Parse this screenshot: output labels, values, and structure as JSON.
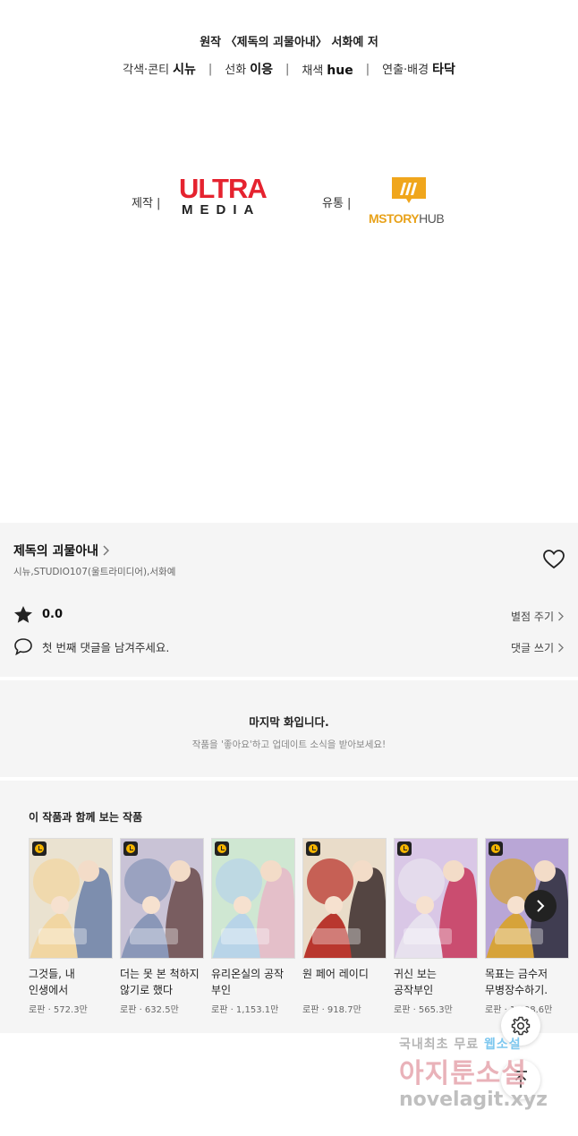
{
  "credits": {
    "original": "원작 〈제독의 괴물아내〉 서화예 저",
    "roles": [
      {
        "role": "각색·콘티",
        "name": "시뉴"
      },
      {
        "role": "선화",
        "name": "이응"
      },
      {
        "role": "채색",
        "name": "hue"
      },
      {
        "role": "연출·배경",
        "name": "타닥"
      }
    ],
    "separator": "|"
  },
  "logos": {
    "production_label": "제작  |",
    "production_logo_line1": "ULTRA",
    "production_logo_line2": "MEDIA",
    "distribution_label": "유통  |",
    "distribution_logo_main": "MSTORY",
    "distribution_logo_sub": "HUB"
  },
  "work": {
    "title": "제독의 괴물아내",
    "authors": "시뉴,STUDIO107(울트라미디어),서화예",
    "score": "0.0",
    "rate_link": "별점 주기",
    "comment_prompt": "첫 번째 댓글을 남겨주세요.",
    "comment_link": "댓글 쓰기"
  },
  "last_episode": {
    "heading": "마지막 화입니다.",
    "subtext": "작품을 '좋아요'하고 업데이트 소식을 받아보세요!"
  },
  "recommended": {
    "heading": "이 작품과 함께 보는 작품",
    "items": [
      {
        "title": "그것들, 내 인생에서 삭제합니다",
        "meta": "로판 · 572.3만",
        "palette": [
          "#eae2d0",
          "#6a7fa8",
          "#f1d6a2"
        ]
      },
      {
        "title": "더는 못 본 척하지 않기로 했다",
        "meta": "로판 · 632.5만",
        "palette": [
          "#c9c3d6",
          "#6b4b4b",
          "#8a97b8"
        ]
      },
      {
        "title": "유리온실의 공작 부인",
        "meta": "로판 · 1,153.1만",
        "palette": [
          "#cfe7d2",
          "#e8b7c8",
          "#b8d4e8"
        ]
      },
      {
        "title": "원 페어 레이디",
        "meta": "로판 · 918.7만",
        "palette": [
          "#e9dcc9",
          "#3a2a2a",
          "#b9372e"
        ]
      },
      {
        "title": "귀신 보는 공작부인",
        "meta": "로판 · 565.3만",
        "palette": [
          "#d9c7e6",
          "#c7375b",
          "#e7e1ee"
        ]
      },
      {
        "title": "목표는 금수저 무병장수하기.",
        "meta": "로판 · 1,098.6만",
        "palette": [
          "#b9a6d6",
          "#2a2a3a",
          "#d6a33a"
        ]
      }
    ]
  },
  "watermark": {
    "line1_a": "국내최초 무료 ",
    "line1_b": "웹소설",
    "line2": "아지툰소설",
    "line3": "novelagit.xyz"
  },
  "colors": {
    "accent_red": "#e5232f",
    "mstory_orange": "#e8a21a",
    "panel_bg": "#f5f5f5"
  },
  "icons": [
    "chevron-right-icon",
    "heart-icon",
    "star-icon",
    "comment-icon",
    "clock-icon",
    "gear-icon",
    "arrow-up-icon"
  ]
}
